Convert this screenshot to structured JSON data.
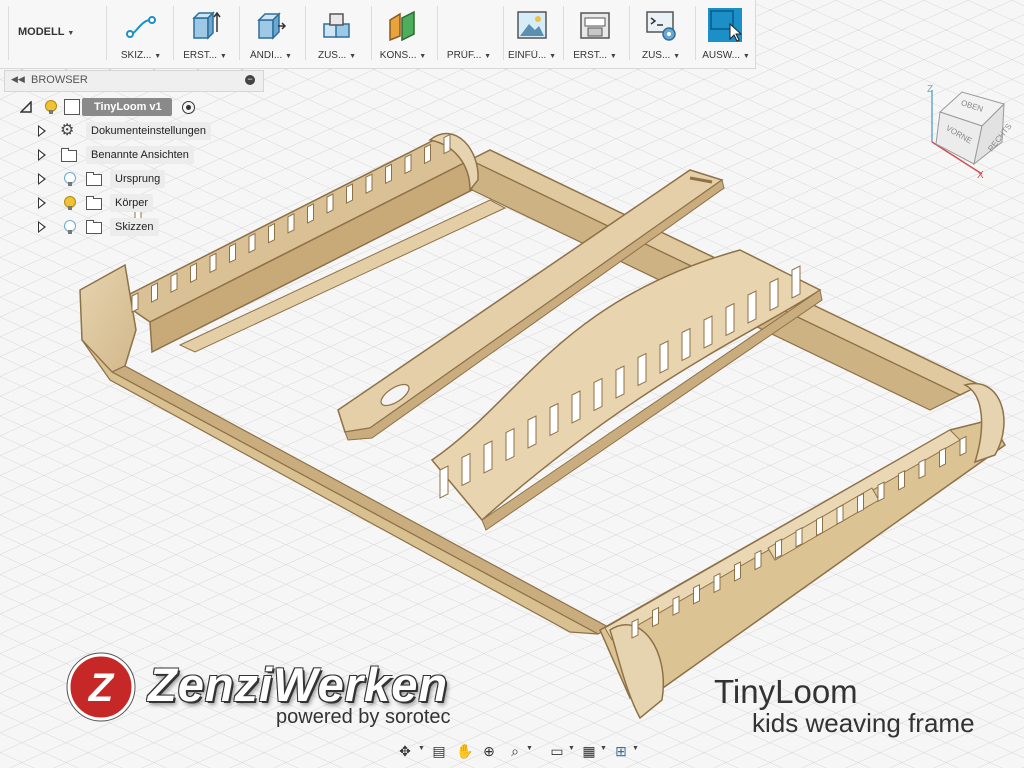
{
  "colors": {
    "wood": "#dcc6a0",
    "wood_dark": "#c9ad7e",
    "wood_edge": "#9b7d52",
    "grid": "#cfcfcf",
    "accent_blue": "#1a8fc8",
    "brand_red": "#c62828"
  },
  "toolbar": {
    "workspace_label": "MODELL",
    "tools": [
      {
        "label": "SKIZ...",
        "icon": "sketch-icon"
      },
      {
        "label": "ERST...",
        "icon": "create-icon"
      },
      {
        "label": "ÄNDI...",
        "icon": "modify-icon"
      },
      {
        "label": "ZUS...",
        "icon": "assemble-icon"
      },
      {
        "label": "KONS...",
        "icon": "construct-icon"
      },
      {
        "label": "PRÜF...",
        "icon": "inspect-icon"
      },
      {
        "label": "EINFÜ...",
        "icon": "insert-icon"
      },
      {
        "label": "ERST...",
        "icon": "make-icon"
      },
      {
        "label": "ZUS...",
        "icon": "addins-icon"
      },
      {
        "label": "AUSW...",
        "icon": "select-icon"
      }
    ]
  },
  "browser": {
    "title": "BROWSER",
    "root": {
      "label": "TinyLoom v1"
    },
    "items": [
      {
        "label": "Dokumenteinstellungen",
        "icon": "gear-icon"
      },
      {
        "label": "Benannte Ansichten",
        "icon": "folder-icon"
      },
      {
        "label": "Ursprung",
        "icon": "folder-icon",
        "visibility": "off"
      },
      {
        "label": "Körper",
        "icon": "folder-icon",
        "visibility": "on"
      },
      {
        "label": "Skizzen",
        "icon": "folder-icon",
        "visibility": "off"
      }
    ]
  },
  "viewcube": {
    "faces": {
      "top": "OBEN",
      "front": "VORNE",
      "right": "RECHTS"
    },
    "axes": {
      "z": "Z",
      "x": "X"
    }
  },
  "watermark": {
    "logo_letter": "Z",
    "brand": "ZenziWerken",
    "powered": "powered by sorotec"
  },
  "product": {
    "title": "TinyLoom",
    "subtitle": "kids weaving frame"
  },
  "navbar": {
    "items": [
      "orbit-icon",
      "look-at-icon",
      "pan-icon",
      "zoom-icon",
      "zoom-window-icon",
      "display-settings-icon",
      "grid-settings-icon",
      "viewports-icon"
    ]
  }
}
